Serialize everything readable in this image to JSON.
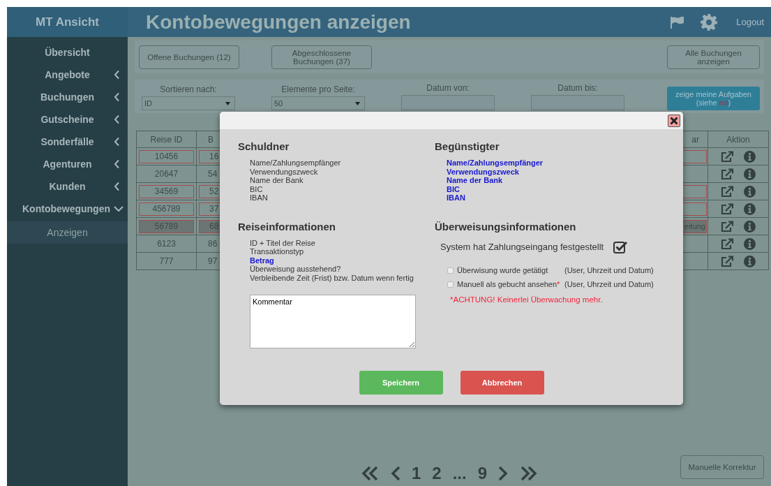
{
  "app_title": "MT Ansicht",
  "page_title": "Kontobewegungen anzeigen",
  "header": {
    "logout": "Logout"
  },
  "sidebar": {
    "items": [
      {
        "label": "Übersicht",
        "kind": "link"
      },
      {
        "label": "Angebote",
        "kind": "menu",
        "expanded": false
      },
      {
        "label": "Buchungen",
        "kind": "menu",
        "expanded": false
      },
      {
        "label": "Gutscheine",
        "kind": "menu",
        "expanded": false
      },
      {
        "label": "Sonderfälle",
        "kind": "menu",
        "expanded": false
      },
      {
        "label": "Agenturen",
        "kind": "menu",
        "expanded": false
      },
      {
        "label": "Kunden",
        "kind": "menu",
        "expanded": false
      },
      {
        "label": "Kontobewegungen",
        "kind": "menu",
        "expanded": true,
        "children": [
          {
            "label": "Anzeigen",
            "selected": true
          }
        ]
      }
    ]
  },
  "toolbar": {
    "buttons": [
      "Offene Buchungen (12)",
      "Abgeschlossene Buchungen (37)",
      "Alle Buchungen anzeigen"
    ]
  },
  "filters": [
    {
      "label": "Sortieren nach:",
      "kind": "select",
      "value": "ID"
    },
    {
      "label": "Elemente pro Seite:",
      "kind": "select",
      "value": "50"
    },
    {
      "label": "Datum von:",
      "kind": "date"
    },
    {
      "label": "Datum bis:",
      "kind": "date"
    }
  ],
  "tasks_button": {
    "text": "zeige meine Aufgaben (siehe ",
    "highlight": "rot",
    "text_end": ")"
  },
  "table": {
    "columns": [
      "Reise ID",
      "B",
      "ar",
      "Aktion"
    ],
    "rows": [
      {
        "reise_id": "10456",
        "column_2": "16",
        "flagged": true,
        "selected": false
      },
      {
        "reise_id": "20647",
        "column_2": "54",
        "flagged": false,
        "selected": false
      },
      {
        "reise_id": "34569",
        "column_2": "52",
        "flagged": true,
        "selected": false
      },
      {
        "reise_id": "456789",
        "column_2": "37",
        "flagged": true,
        "selected": false
      },
      {
        "reise_id": "56789",
        "column_2": "68",
        "column_3": "eitung",
        "flagged": true,
        "selected": true
      },
      {
        "reise_id": "6123",
        "column_2": "86",
        "flagged": false,
        "selected": false
      },
      {
        "reise_id": "777",
        "column_2": "97",
        "flagged": false,
        "selected": false
      }
    ]
  },
  "modal": {
    "sections": [
      {
        "title": "Schuldner",
        "lines": [
          {
            "text": "Name/Zahlungsempfänger",
            "highlighted": false
          },
          {
            "text": "Verwendungszweck",
            "highlighted": false
          },
          {
            "text": "Name der Bank",
            "highlighted": false
          },
          {
            "text": "BIC",
            "highlighted": false
          },
          {
            "text": "IBAN",
            "highlighted": false
          }
        ]
      },
      {
        "title": "Begünstigter",
        "lines": [
          {
            "text": "Name/Zahlungsempfänger",
            "highlighted": true
          },
          {
            "text": "Verwendungszweck",
            "highlighted": true
          },
          {
            "text": "Name der Bank",
            "highlighted": true
          },
          {
            "text": "BIC",
            "highlighted": true
          },
          {
            "text": "IBAN",
            "highlighted": true
          }
        ]
      },
      {
        "title": "Reiseinformationen",
        "lines": [
          {
            "text": "ID + Titel der Reise",
            "highlighted": false
          },
          {
            "text": "Transaktionstyp",
            "highlighted": false
          },
          {
            "text": "Betrag",
            "highlighted": true
          },
          {
            "text": "Überweisung ausstehend?",
            "highlighted": false
          },
          {
            "text": "Verbleibende Zeit (Frist) bzw. Datum wenn fertig",
            "highlighted": false
          }
        ]
      }
    ],
    "comment": "Kommentar",
    "transfer_title": "Überweisungsinformationen",
    "system_check": {
      "label": "System hat Zahlungseingang festgestellt",
      "checked": true
    },
    "options": [
      {
        "label": "Überwisung wurde getätigt",
        "note": "(User, Uhrzeit und Datum)",
        "checked": false
      },
      {
        "label": "Manuell als gebucht ansehen",
        "required_mark": "*",
        "note": "(User, Uhrzeit und Datum)",
        "checked": false
      }
    ],
    "warning": "*ACHTUNG! Keinerlei Überwachung mehr.",
    "save": "Speichern",
    "cancel": "Abbrechen"
  },
  "pagination": {
    "pages": [
      "1",
      "2",
      "...",
      "9"
    ]
  },
  "correction_button": "Manuelle Korrektur"
}
